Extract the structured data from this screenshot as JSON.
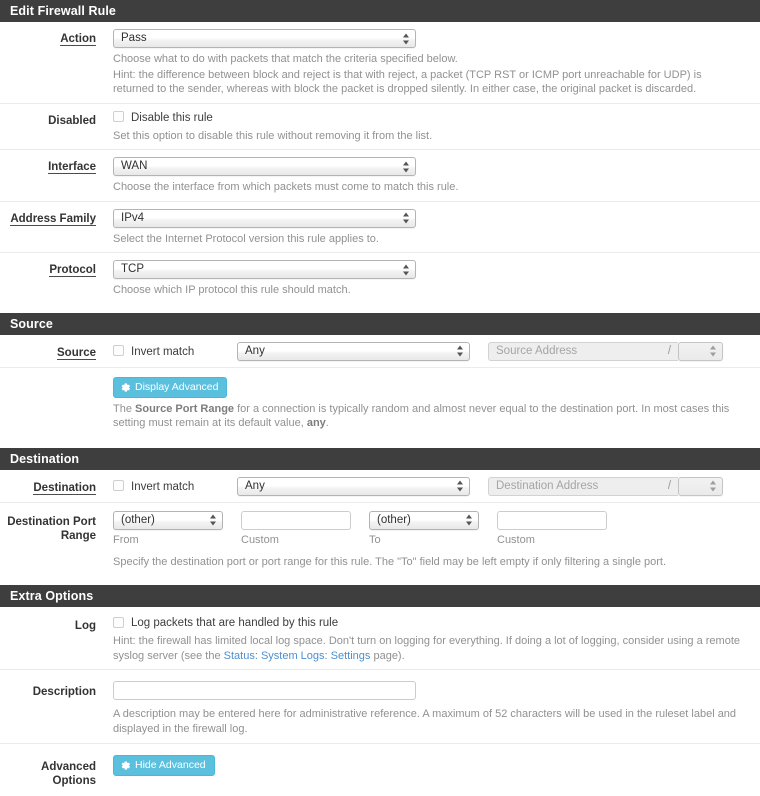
{
  "colors": {
    "panel_heading_bg": "#3e3e3e",
    "panel_heading_text": "#ffffff",
    "info_button_bg": "#5bc0de",
    "link": "#4b8fd1",
    "help_text": "#919191"
  },
  "sections": {
    "edit_rule": {
      "title": "Edit Firewall Rule"
    },
    "source": {
      "title": "Source"
    },
    "destination": {
      "title": "Destination"
    },
    "extra_options": {
      "title": "Extra Options"
    }
  },
  "fields": {
    "action": {
      "label": "Action",
      "value": "Pass",
      "help_line1": "Choose what to do with packets that match the criteria specified below.",
      "help_line2": "Hint: the difference between block and reject is that with reject, a packet (TCP RST or ICMP port unreachable for UDP) is returned to the sender, whereas with block the packet is dropped silently. In either case, the original packet is discarded."
    },
    "disabled": {
      "label": "Disabled",
      "checkbox_label": "Disable this rule",
      "checked": false,
      "help": "Set this option to disable this rule without removing it from the list."
    },
    "interface": {
      "label": "Interface",
      "value": "WAN",
      "help": "Choose the interface from which packets must come to match this rule."
    },
    "address_family": {
      "label": "Address Family",
      "value": "IPv4",
      "help": "Select the Internet Protocol version this rule applies to."
    },
    "protocol": {
      "label": "Protocol",
      "value": "TCP",
      "help": "Choose which IP protocol this rule should match."
    },
    "source": {
      "label": "Source",
      "invert_label": "Invert match",
      "invert_checked": false,
      "type_value": "Any",
      "address_placeholder": "Source Address",
      "address_value": "",
      "slash": "/",
      "mask_value": ""
    },
    "source_port_button": {
      "label": "Display Advanced",
      "icon": "gear-icon"
    },
    "source_port_help": {
      "prefix": "The ",
      "bold1": "Source Port Range",
      "middle": " for a connection is typically random and almost never equal to the destination port. In most cases this setting must remain at its default value, ",
      "bold2": "any",
      "suffix": "."
    },
    "destination": {
      "label": "Destination",
      "invert_label": "Invert match",
      "invert_checked": false,
      "type_value": "Any",
      "address_placeholder": "Destination Address",
      "address_value": "",
      "slash": "/",
      "mask_value": ""
    },
    "destination_port_range": {
      "label": "Destination Port Range",
      "from_value": "(other)",
      "from_caption": "From",
      "custom_from_value": "",
      "custom_from_caption": "Custom",
      "to_value": "(other)",
      "to_caption": "To",
      "custom_to_value": "",
      "custom_to_caption": "Custom",
      "help": "Specify the destination port or port range for this rule. The \"To\" field may be left empty if only filtering a single port."
    },
    "log": {
      "label": "Log",
      "checkbox_label": "Log packets that are handled by this rule",
      "checked": false,
      "help_prefix": "Hint: the firewall has limited local log space. Don't turn on logging for everything. If doing a lot of logging, consider using a remote syslog server (see the ",
      "help_link": "Status: System Logs: Settings",
      "help_suffix": " page)."
    },
    "description": {
      "label": "Description",
      "value": "",
      "placeholder": "",
      "help": "A description may be entered here for administrative reference. A maximum of 52 characters will be used in the ruleset label and displayed in the firewall log."
    },
    "advanced_options": {
      "label": "Advanced Options",
      "button_label": "Hide Advanced",
      "icon": "gear-icon"
    }
  }
}
